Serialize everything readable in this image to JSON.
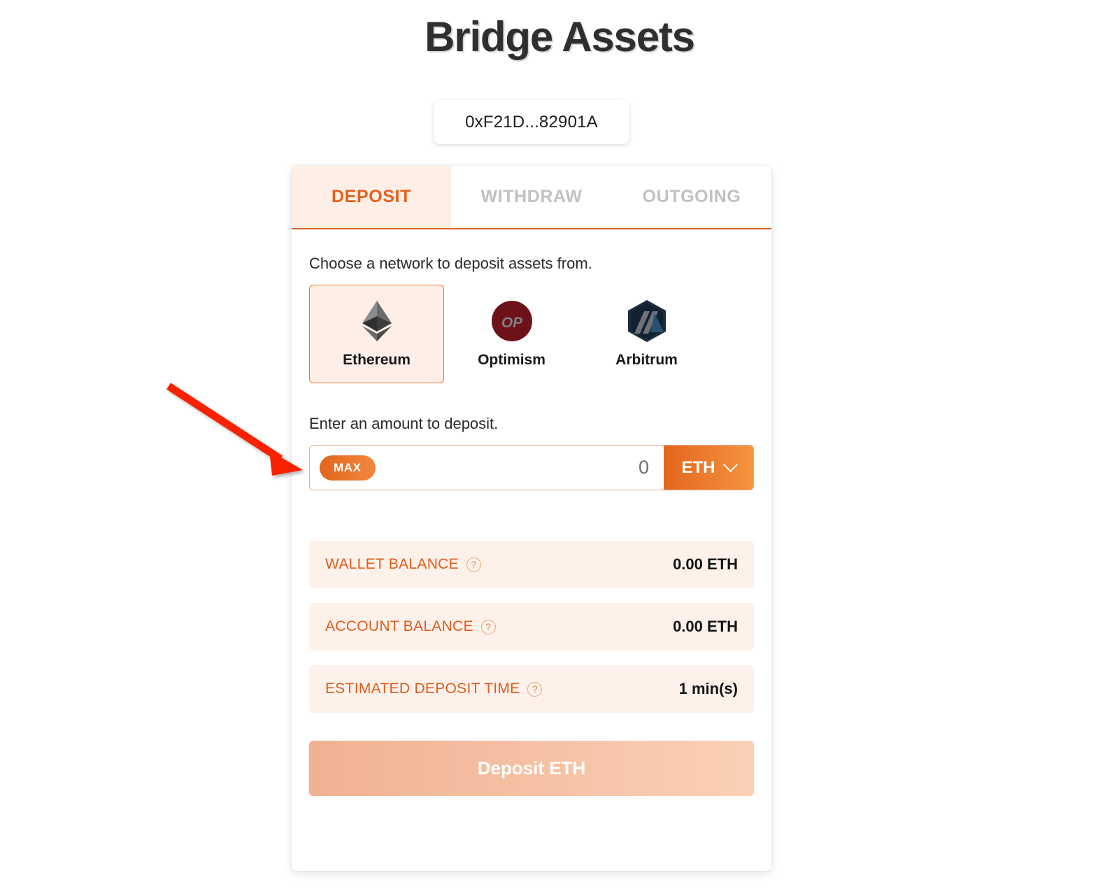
{
  "header": {
    "title": "Bridge Assets",
    "wallet_address": "0xF21D...82901A"
  },
  "tabs": [
    {
      "label": "DEPOSIT",
      "active": true
    },
    {
      "label": "WITHDRAW",
      "active": false
    },
    {
      "label": "OUTGOING",
      "active": false
    }
  ],
  "network_section": {
    "prompt": "Choose a network to deposit assets from.",
    "networks": [
      {
        "name": "Ethereum",
        "icon": "ethereum-icon",
        "selected": true
      },
      {
        "name": "Optimism",
        "icon": "optimism-icon",
        "selected": false
      },
      {
        "name": "Arbitrum",
        "icon": "arbitrum-icon",
        "selected": false
      }
    ]
  },
  "amount_section": {
    "prompt": "Enter an amount to deposit.",
    "max_label": "MAX",
    "amount_value": "0",
    "amount_placeholder": "0",
    "token": "ETH",
    "chevron_icon": "chevron-down-icon"
  },
  "info_rows": [
    {
      "label": "WALLET BALANCE",
      "help": "?",
      "value": "0.00 ETH"
    },
    {
      "label": "ACCOUNT BALANCE",
      "help": "?",
      "value": "0.00 ETH"
    },
    {
      "label": "ESTIMATED DEPOSIT TIME",
      "help": "?",
      "value": "1 min(s)"
    }
  ],
  "submit": {
    "label": "Deposit ETH"
  },
  "annotation": {
    "type": "arrow",
    "color": "#F92200",
    "points_to": "max-button"
  },
  "colors": {
    "accent": "#E4601F",
    "accent_light": "#FDEEE6",
    "row_bg": "#FDF1EA",
    "tab_inactive": "#C1C1C1",
    "disabled_button": "#F0B192"
  }
}
